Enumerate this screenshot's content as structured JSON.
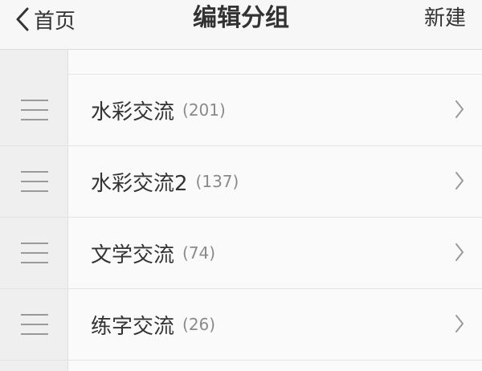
{
  "navbar": {
    "back_label": "首页",
    "title": "编辑分组",
    "new_label": "新建"
  },
  "groups": [
    {
      "name": "水彩交流",
      "count": "(201)"
    },
    {
      "name": "水彩交流2",
      "count": "(137)"
    },
    {
      "name": "文学交流",
      "count": "(74)"
    },
    {
      "name": "练字交流",
      "count": "(26)"
    }
  ],
  "icons": {
    "back": "chevron-left-icon",
    "row_arrow": "chevron-right-icon",
    "drag": "drag-handle-icon"
  },
  "colors": {
    "text": "#333333",
    "count": "#8a8a8a",
    "handle": "#9a9a9a"
  }
}
